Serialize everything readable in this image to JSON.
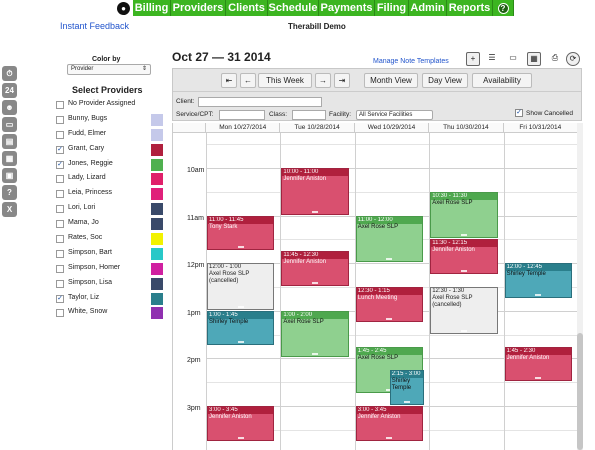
{
  "nav": {
    "items": [
      "Billing",
      "Providers",
      "Clients",
      "Schedule",
      "Payments",
      "Filing",
      "Admin",
      "Reports"
    ],
    "help_label": "?"
  },
  "header": {
    "feedback_link": "Instant Feedback",
    "app_title": "Therabill Demo"
  },
  "left": {
    "color_by_label": "Color by",
    "color_by_value": "Provider",
    "providers_title": "Select Providers",
    "providers": [
      {
        "name": "No Provider Assigned",
        "checked": false,
        "color": ""
      },
      {
        "name": "Bunny, Bugs",
        "checked": false,
        "color": "#c5c9ea"
      },
      {
        "name": "Fudd, Elmer",
        "checked": false,
        "color": "#c5c9ea"
      },
      {
        "name": "Grant, Cary",
        "checked": true,
        "color": "#b0203d"
      },
      {
        "name": "Jones, Reggie",
        "checked": true,
        "color": "#4fb04f"
      },
      {
        "name": "Lady, Lizard",
        "checked": false,
        "color": "#e0206a"
      },
      {
        "name": "Leia, Princess",
        "checked": false,
        "color": "#e0207a"
      },
      {
        "name": "Lori, Lori",
        "checked": false,
        "color": "#3a4a6a"
      },
      {
        "name": "Mama, Jo",
        "checked": false,
        "color": "#3a4a6a"
      },
      {
        "name": "Rates, Soc",
        "checked": false,
        "color": "#f2f200"
      },
      {
        "name": "Simpson, Bart",
        "checked": false,
        "color": "#28c8c8"
      },
      {
        "name": "Simpson, Homer",
        "checked": false,
        "color": "#d020a0"
      },
      {
        "name": "Simpson, Lisa",
        "checked": false,
        "color": "#3a4a6a"
      },
      {
        "name": "Taylor, Liz",
        "checked": true,
        "color": "#2a7f8c"
      },
      {
        "name": "White, Snow",
        "checked": false,
        "color": "#9030b0"
      }
    ],
    "side_icons": [
      "clock-icon",
      "calendar-24-icon",
      "person-icon",
      "folder-icon",
      "card-icon",
      "calculator-icon",
      "id-card-icon",
      "help-icon",
      "close-icon"
    ]
  },
  "calendar": {
    "week_title": "Oct 27 — 31 2014",
    "manage_link": "Manage Note Templates",
    "nav_buttons": {
      "first": "⇤",
      "prev": "←",
      "this_week": "This Week",
      "next": "→",
      "last": "⇥"
    },
    "views": {
      "month": "Month View",
      "day": "Day View",
      "availability": "Availability"
    },
    "filters": {
      "client_label": "Client:",
      "service_label": "Service/CPT:",
      "class_label": "Class:",
      "facility_label": "Facility:",
      "facility_value": "All Service Facilities",
      "show_cancelled_label": "Show Cancelled",
      "show_cancelled": true
    },
    "days": [
      "Mon 10/27/2014",
      "Tue 10/28/2014",
      "Wed 10/29/2014",
      "Thu 10/30/2014",
      "Fri 10/31/2014"
    ],
    "time_labels": [
      "10am",
      "11am",
      "12pm",
      "1pm",
      "2pm",
      "3pm"
    ],
    "appointments": [
      {
        "day": 0,
        "start": "11:00",
        "end": "11:45",
        "time": "11:00 - 11:45",
        "title": "Tony Stark",
        "style": "red"
      },
      {
        "day": 0,
        "start": "12:00",
        "end": "1:00",
        "time": "12:00 - 1:00",
        "title": "Axel Rose SLP",
        "note": "(cancelled)",
        "style": "grey"
      },
      {
        "day": 0,
        "start": "1:00",
        "end": "1:45",
        "time": "1:00 - 1:45",
        "title": "Shirley Temple",
        "style": "teal"
      },
      {
        "day": 0,
        "start": "3:00",
        "end": "3:45",
        "time": "3:00 - 3:45",
        "title": "Jennifer Aniston",
        "style": "red"
      },
      {
        "day": 1,
        "start": "10:00",
        "end": "11:00",
        "time": "10:00 - 11:00",
        "title": "Jennifer Aniston",
        "style": "red"
      },
      {
        "day": 1,
        "start": "11:45",
        "end": "12:30",
        "time": "11:45 - 12:30",
        "title": "Jennifer Aniston",
        "style": "red"
      },
      {
        "day": 1,
        "start": "1:00",
        "end": "2:00",
        "time": "1:00 - 2:00",
        "title": "Axel Rose SLP",
        "style": "green"
      },
      {
        "day": 2,
        "start": "11:00",
        "end": "12:00",
        "time": "11:00 - 12:00",
        "title": "Axel Rose SLP",
        "style": "green"
      },
      {
        "day": 2,
        "start": "12:30",
        "end": "1:15",
        "time": "12:30 - 1:15",
        "title": "Lunch Meeting",
        "style": "red"
      },
      {
        "day": 2,
        "start": "1:45",
        "end": "2:45",
        "time": "1:45 - 2:45",
        "title": "Axel Rose SLP",
        "style": "green"
      },
      {
        "day": 2,
        "start": "2:15",
        "end": "3:00",
        "time": "2:15 - 3:00",
        "title": "Shirley Temple",
        "style": "teal",
        "offset": true
      },
      {
        "day": 2,
        "start": "3:00",
        "end": "3:45",
        "time": "3:00 - 3:45",
        "title": "Jennifer Aniston",
        "style": "red"
      },
      {
        "day": 3,
        "start": "10:30",
        "end": "11:30",
        "time": "10:30 - 11:30",
        "title": "Axel Rose SLP",
        "style": "green"
      },
      {
        "day": 3,
        "start": "11:30",
        "end": "12:15",
        "time": "11:30 - 12:15",
        "title": "Jennifer Aniston",
        "style": "red"
      },
      {
        "day": 3,
        "start": "12:30",
        "end": "1:30",
        "time": "12:30 - 1:30",
        "title": "Axel Rose SLP",
        "note": "(cancelled)",
        "style": "grey"
      },
      {
        "day": 4,
        "start": "12:00",
        "end": "12:45",
        "time": "12:00 - 12:45",
        "title": "Shirley Temple",
        "style": "teal"
      },
      {
        "day": 4,
        "start": "1:45",
        "end": "2:30",
        "time": "1:45 - 2:30",
        "title": "Jennifer Aniston",
        "style": "red"
      }
    ]
  }
}
